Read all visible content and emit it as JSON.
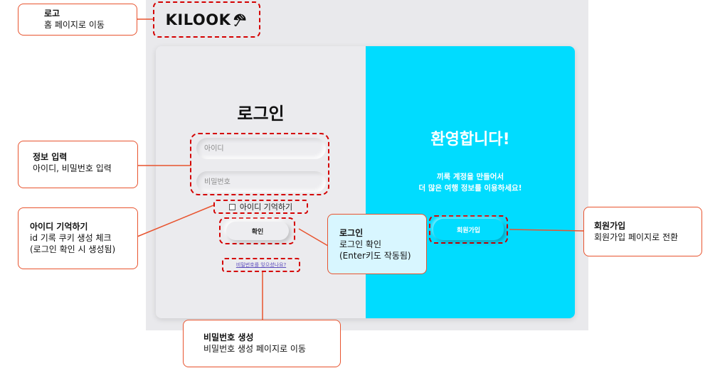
{
  "logo": {
    "text": "KILOOK"
  },
  "login": {
    "title": "로그인",
    "id_placeholder": "아이디",
    "pw_placeholder": "비밀번호",
    "remember_label": "아이디 기억하기",
    "login_button": "확인",
    "forgot_link": "비밀번호를 잊으셨나요?"
  },
  "welcome": {
    "title": "환영합니다!",
    "line1": "끼룩 계정을 만들어서",
    "line2": "더 많은 여행 정보를 이용하세요!",
    "signup_button": "회원가입"
  },
  "annotations": {
    "logo": {
      "title": "로고",
      "desc": "홈 페이지로 이동"
    },
    "info": {
      "title": "정보 입력",
      "desc": "아이디, 비밀번호 입력"
    },
    "remember": {
      "title": "아이디 기억하기",
      "desc1": "id 기록 쿠키 생성 체크",
      "desc2": "(로그인 확인 시 생성됨)"
    },
    "login": {
      "title": "로그인",
      "desc1": "로그인 확인",
      "desc2": "(Enter키도 작동됨)"
    },
    "signup": {
      "title": "회원가입",
      "desc": "회원가입 페이지로 전환"
    },
    "password": {
      "title": "비밀번호 생성",
      "desc": "비밀번호 생성 페이지로 이동"
    }
  },
  "colors": {
    "accent": "#00dcff",
    "annotation_line": "#e8542f",
    "highlight": "#d40000"
  }
}
